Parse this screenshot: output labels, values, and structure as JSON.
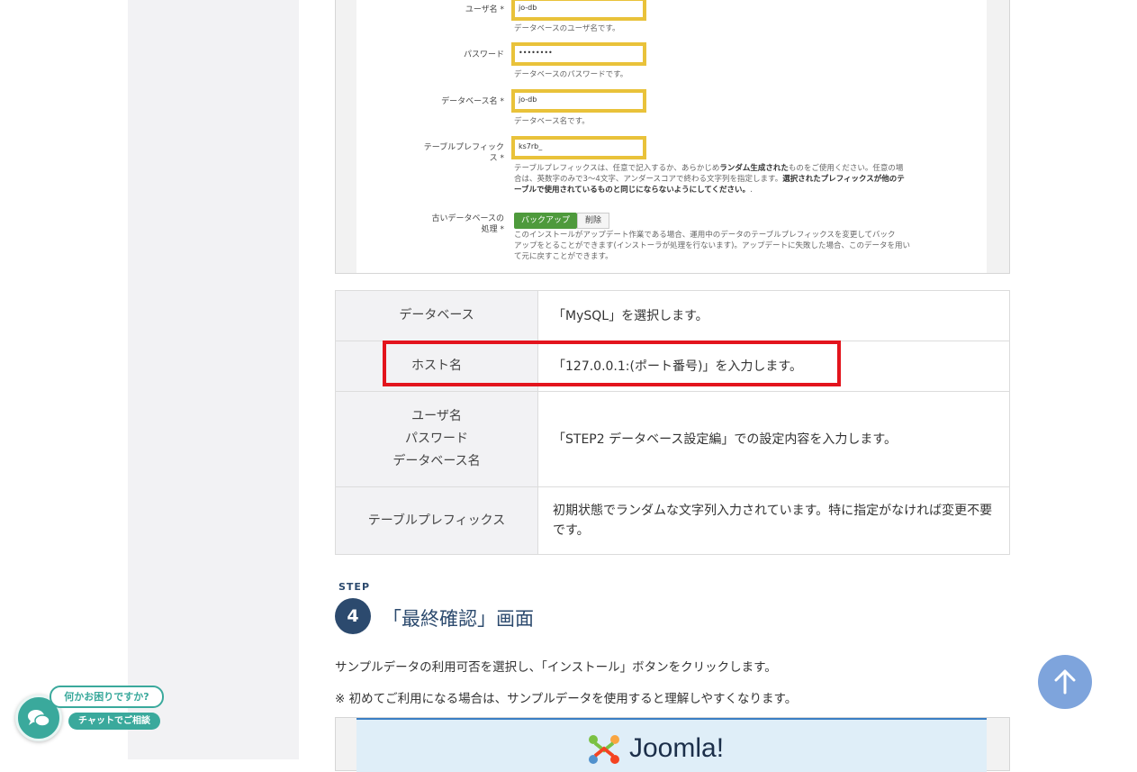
{
  "form": {
    "username": {
      "label": "ユーザ名 *",
      "value": "jo-db",
      "help": "データベースのユーザ名です。"
    },
    "password": {
      "label": "パスワード",
      "value": "••••••••",
      "help": "データベースのパスワードです。"
    },
    "dbname": {
      "label": "データベース名 *",
      "value": "jo-db",
      "help": "データベース名です。"
    },
    "prefix": {
      "label_line1": "テーブルプレフィック",
      "label_line2": "ス *",
      "value": "ks7rb_",
      "help_line1_a": "テーブルプレフィックスは、任意で記入するか、あらかじめ",
      "help_line1_b": "ランダム生成された",
      "help_line1_c": "ものをご使用ください。任意の場",
      "help_line2_a": "合は、英数字のみで3〜4文字、アンダースコアで終わる文字列を指定します。",
      "help_line2_b": "選択されたプレフィックスが他のテ",
      "help_line3_b": "ーブルで使用されているものと同じにならないようにしてください。",
      "help_line3_c": "."
    },
    "old_db": {
      "label_line1": "古いデータベースの",
      "label_line2": "処理 *",
      "backup_label": "バックアップ",
      "delete_label": "削除",
      "help_line1": "このインストールがアップデート作業である場合、運用中のデータのテーブルプレフィックスを変更してバック",
      "help_line2": "アップをとることができます(インストーラが処理を行ないます)。アップデートに失敗した場合、このデータを用い",
      "help_line3": "て元に戻すことができます。"
    }
  },
  "table": {
    "rows": [
      {
        "head": "データベース",
        "value": "「MySQL」を選択します。"
      },
      {
        "head": "ホスト名",
        "value": "「127.0.0.1:(ポート番号)」を入力します。"
      },
      {
        "head_line1": "ユーザ名",
        "head_line2": "パスワード",
        "head_line3": "データベース名",
        "value": "「STEP2 データベース設定編」での設定内容を入力します。"
      },
      {
        "head": "テーブルプレフィックス",
        "value_line1": "初期状態でランダムな文字列入力されています。特に指定がなければ変更不要",
        "value_line2": "です。"
      }
    ]
  },
  "step": {
    "small_label": "STEP",
    "number": "4",
    "title": "「最終確認」画面",
    "para1": "サンプルデータの利用可否を選択し、「インストール」ボタンをクリックします。",
    "para2": "※ 初めてご利用になる場合は、サンプルデータを使用すると理解しやすくなります。"
  },
  "joomla": {
    "wordmark": "Joomla!"
  },
  "chat": {
    "question": "何かお困りですか?",
    "button": "チャットでご相談"
  },
  "colors": {
    "highlight_yellow": "#e9c23a",
    "highlight_red": "#e3141d",
    "step_navy": "#2c4a6e",
    "chat_teal": "#3aa99c",
    "top_button": "#7ea4dc"
  }
}
